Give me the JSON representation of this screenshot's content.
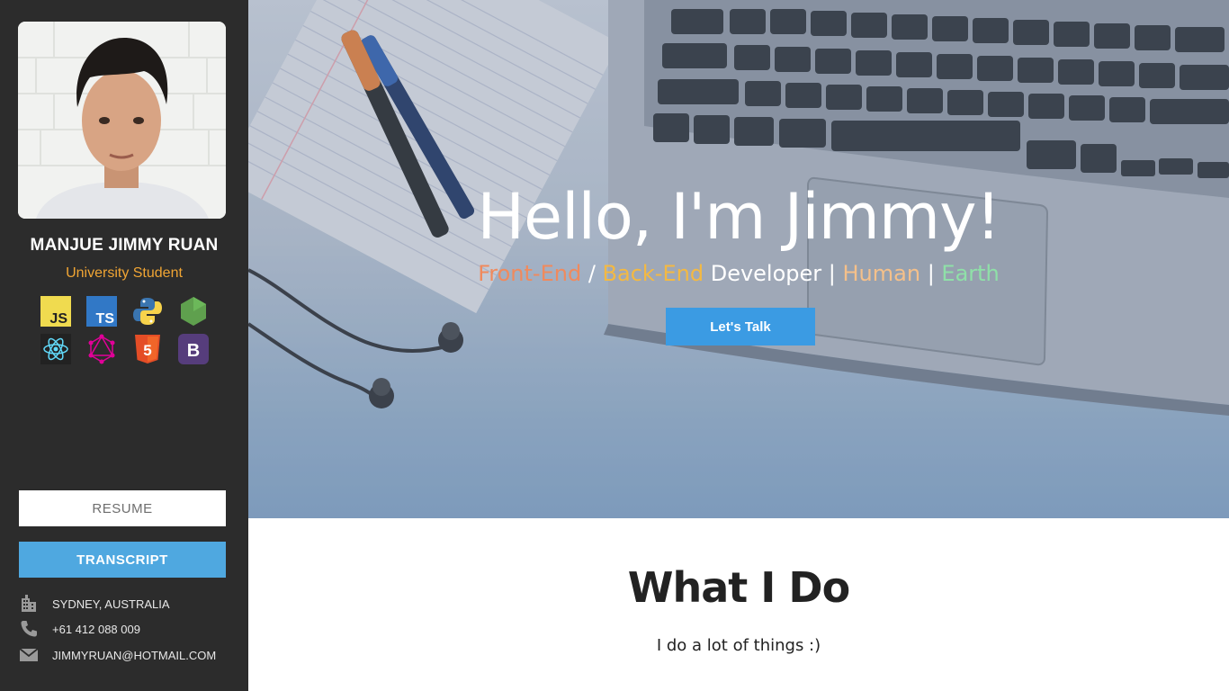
{
  "sidebar": {
    "name": "MANJUE JIMMY RUAN",
    "role": "University Student",
    "skills": [
      {
        "icon": "javascript-icon",
        "label": "JS"
      },
      {
        "icon": "typescript-icon",
        "label": "TS"
      },
      {
        "icon": "python-icon"
      },
      {
        "icon": "nodejs-icon"
      },
      {
        "icon": "react-icon"
      },
      {
        "icon": "graphql-icon"
      },
      {
        "icon": "html5-icon",
        "label": "5"
      },
      {
        "icon": "bootstrap-icon",
        "label": "B"
      }
    ],
    "resume_label": "RESUME",
    "transcript_label": "TRANSCRIPT",
    "contact": {
      "location": "SYDNEY, AUSTRALIA",
      "phone": "+61 412 088 009",
      "email": "JIMMYRUAN@HOTMAIL.COM"
    }
  },
  "hero": {
    "title": "Hello, I'm Jimmy!",
    "subtitle": {
      "front": "Front-End",
      "slash": " / ",
      "back": "Back-End",
      "developer": " Developer ",
      "bar1": "|",
      "human": " Human ",
      "bar2": "|",
      "earth": " Earth"
    },
    "cta_label": "Let's Talk"
  },
  "section": {
    "title": "What I Do",
    "subtitle": "I do a lot of things :)"
  },
  "colors": {
    "sidebar_bg": "#2c2c2c",
    "accent_orange": "#f0a534",
    "transcript_blue": "#4fa8e0",
    "cta_blue": "#3b9be3"
  }
}
